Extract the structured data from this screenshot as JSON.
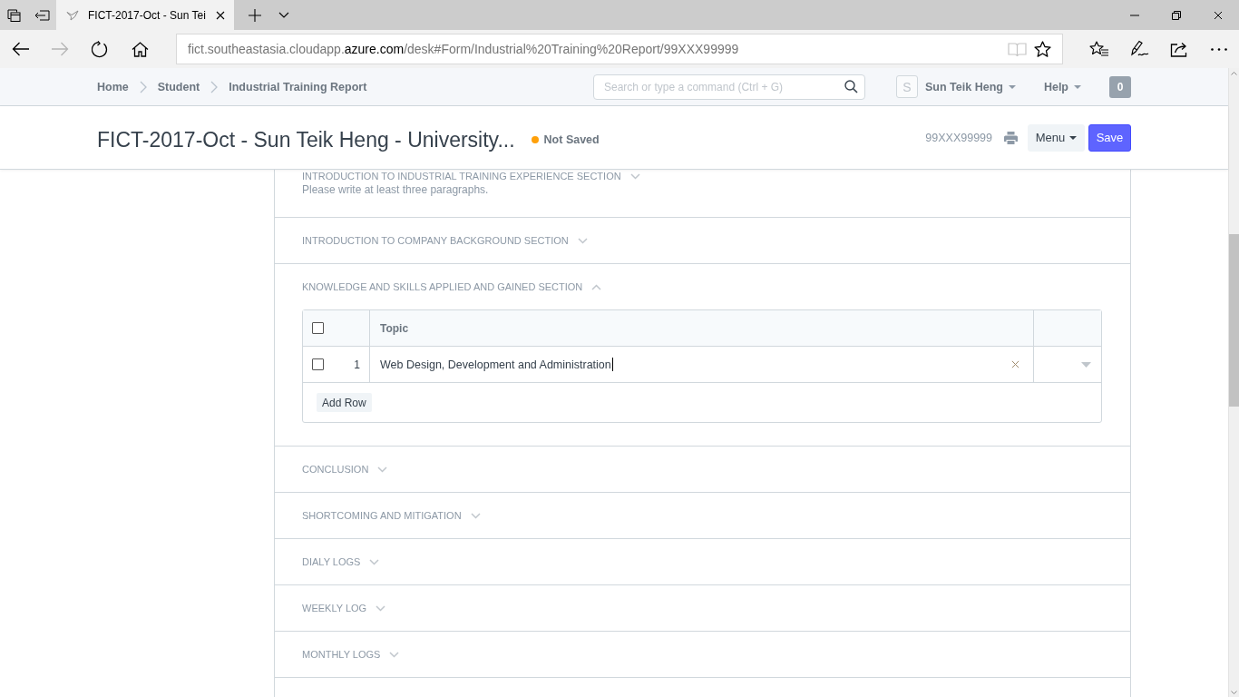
{
  "browser": {
    "tabs": [
      {
        "title": "FICT-2017-Oct - Sun Tei",
        "selected": true
      }
    ],
    "nav_buttons": [
      {
        "kind": "back",
        "disabled": false
      },
      {
        "kind": "forward",
        "disabled": true
      },
      {
        "kind": "refresh",
        "disabled": false
      },
      {
        "kind": "home",
        "disabled": false
      }
    ],
    "address": {
      "subdomain": "fict.southeastasia.cloudapp.",
      "domain": "azure.com",
      "path": "/desk#Form/Industrial%20Training%20Report/99XXX99999"
    },
    "reading_view": {
      "disabled": true
    }
  },
  "navbar": {
    "breadcrumbs": [
      "Home",
      "Student",
      "Industrial Training Report"
    ],
    "search": {
      "placeholder": "Search or type a command (Ctrl + G)"
    },
    "avatar": "S",
    "user_menu": "Sun Teik Heng",
    "help_menu": "Help",
    "notifications": "0"
  },
  "page_head": {
    "title": "FICT-2017-Oct - Sun Teik Heng - University...",
    "indicator": "Not Saved",
    "doc_name": "99XXX99999",
    "buttons": [
      {
        "label": "Menu",
        "kind": "dropdown"
      },
      {
        "label": "Save",
        "kind": "primary"
      }
    ]
  },
  "form": {
    "sections": [
      {
        "title": "INTRODUCTION TO INDUSTRIAL TRAINING EXPERIENCE SECTION",
        "expanded": false,
        "description": "Please write at least three paragraphs."
      },
      {
        "title": "INTRODUCTION TO COMPANY BACKGROUND SECTION",
        "expanded": false
      },
      {
        "title": "KNOWLEDGE AND SKILLS APPLIED AND GAINED SECTION",
        "expanded": true,
        "table": {
          "select_all": {
            "checked": false
          },
          "columns": [
            {
              "label": "Topic"
            }
          ],
          "rows": [
            {
              "checked": false,
              "number": "1",
              "topic": "Web Design, Development and Administration",
              "editing": true
            }
          ],
          "add_row": "Add Row"
        }
      },
      {
        "title": "CONCLUSION",
        "expanded": false
      },
      {
        "title": "SHORTCOMING AND MITIGATION",
        "expanded": false
      },
      {
        "title": "DIALY LOGS",
        "expanded": false
      },
      {
        "title": "WEEKLY LOG",
        "expanded": false
      },
      {
        "title": "MONTHLY LOGS",
        "expanded": false
      }
    ]
  }
}
